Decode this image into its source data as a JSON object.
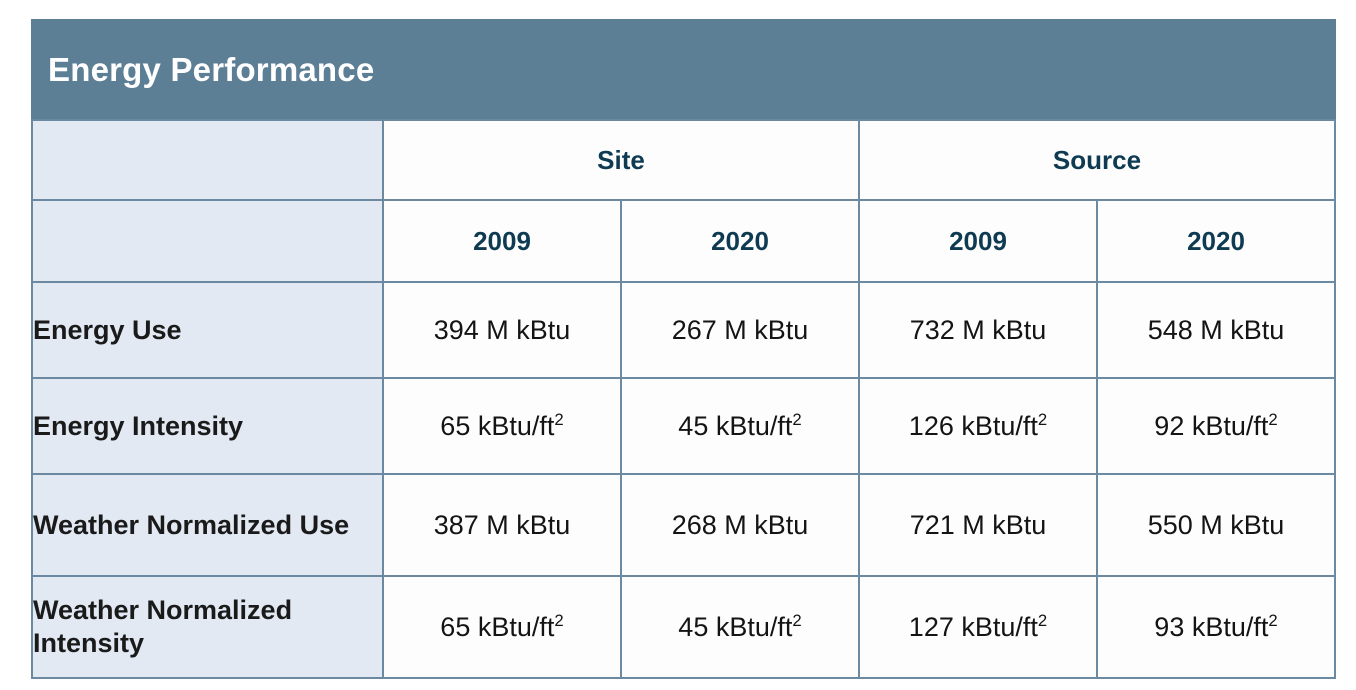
{
  "card": {
    "title": "Energy Performance",
    "colors": {
      "title_band": "#5d7f96",
      "label_column": "#e2e9f3",
      "border": "#6b8aa1",
      "header_text": "#0f3b52",
      "body_text": "#141414",
      "cell_background": "#fdfdfd"
    }
  },
  "table": {
    "corner_label": "",
    "group_headers": [
      {
        "label": "Site",
        "span": 2
      },
      {
        "label": "Source",
        "span": 2
      }
    ],
    "year_headers": [
      "2009",
      "2020",
      "2009",
      "2020"
    ],
    "rows": [
      {
        "label": "Energy Use",
        "values": [
          {
            "number": "394",
            "unit": "M kBtu",
            "squared": false
          },
          {
            "number": "267",
            "unit": "M kBtu",
            "squared": false
          },
          {
            "number": "732",
            "unit": "M kBtu",
            "squared": false
          },
          {
            "number": "548",
            "unit": "M kBtu",
            "squared": false
          }
        ]
      },
      {
        "label": "Energy Intensity",
        "values": [
          {
            "number": "65",
            "unit": "kBtu/ft",
            "squared": true
          },
          {
            "number": "45",
            "unit": "kBtu/ft",
            "squared": true
          },
          {
            "number": "126",
            "unit": "kBtu/ft",
            "squared": true
          },
          {
            "number": "92",
            "unit": "kBtu/ft",
            "squared": true
          }
        ]
      },
      {
        "label": "Weather Normalized Use",
        "values": [
          {
            "number": "387",
            "unit": "M kBtu",
            "squared": false
          },
          {
            "number": "268",
            "unit": "M kBtu",
            "squared": false
          },
          {
            "number": "721",
            "unit": "M kBtu",
            "squared": false
          },
          {
            "number": "550",
            "unit": "M kBtu",
            "squared": false
          }
        ]
      },
      {
        "label": "Weather Normalized Intensity",
        "values": [
          {
            "number": "65",
            "unit": "kBtu/ft",
            "squared": true
          },
          {
            "number": "45",
            "unit": "kBtu/ft",
            "squared": true
          },
          {
            "number": "127",
            "unit": "kBtu/ft",
            "squared": true
          },
          {
            "number": "93",
            "unit": "kBtu/ft",
            "squared": true
          }
        ]
      }
    ]
  }
}
